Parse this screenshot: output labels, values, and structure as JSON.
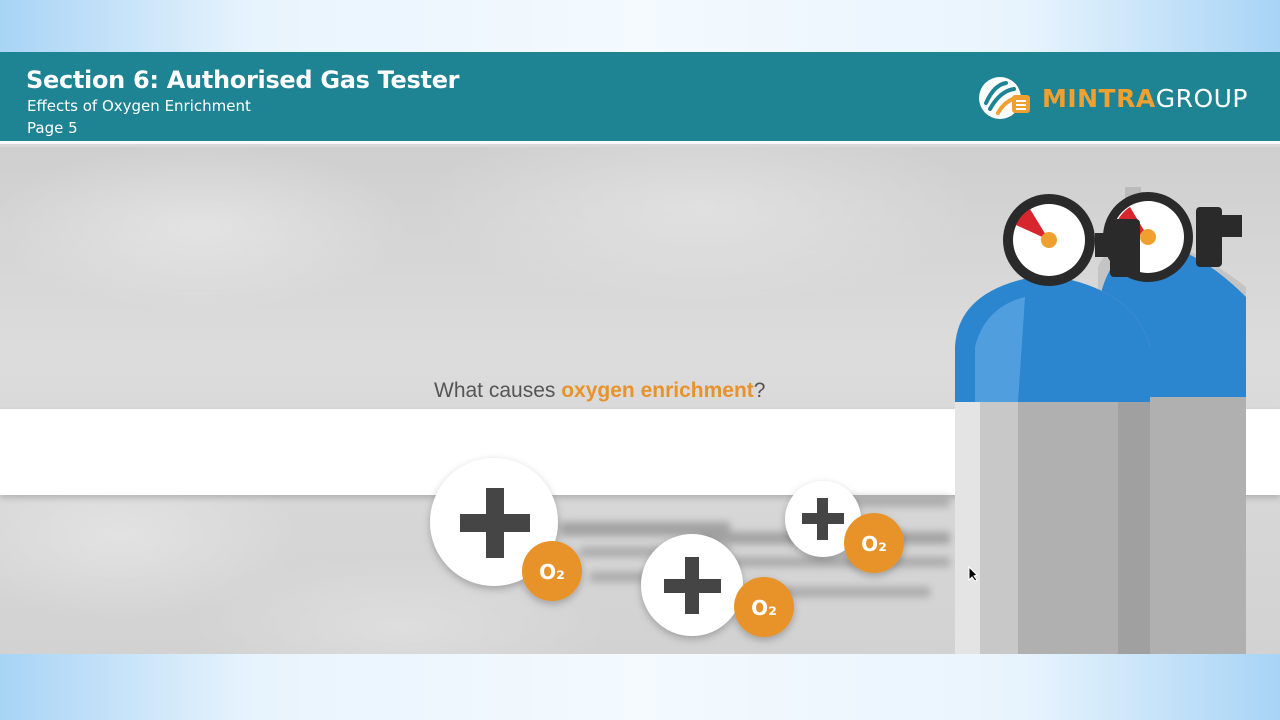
{
  "header": {
    "title": "Section 6: Authorised Gas Tester",
    "subtitle": "Effects of Oxygen Enrichment",
    "page": "Page 5"
  },
  "brand": {
    "name_part1": "MINTRA",
    "name_part2": "GROUP",
    "logo_icon": "mintra-logo-icon"
  },
  "question": {
    "prefix": "What causes ",
    "highlight": "oxygen enrichment",
    "suffix": "?"
  },
  "molecules": {
    "label": "O₂",
    "icon": "plus-icon"
  },
  "colors": {
    "header": "#1e8494",
    "accent": "#e8922a",
    "cylinder_blue": "#2b86cf",
    "cylinder_grey": "#c8c8c8"
  }
}
